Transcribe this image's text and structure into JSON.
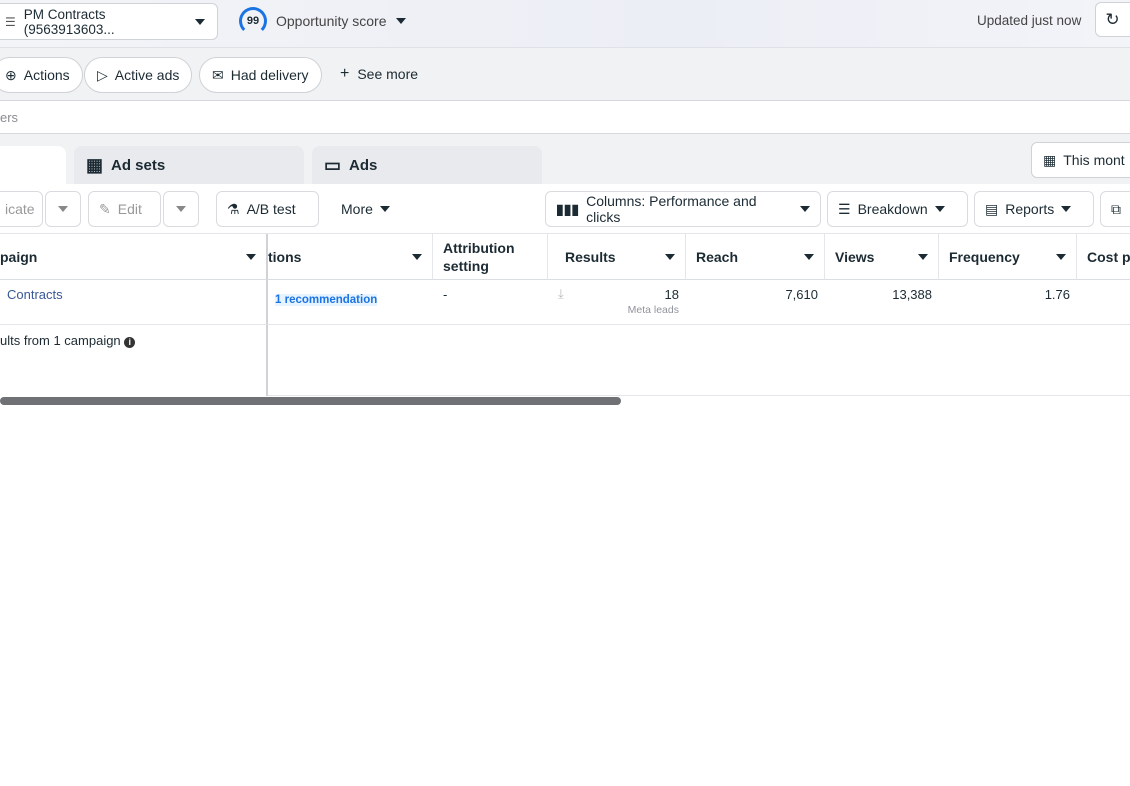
{
  "header": {
    "account": "PM Contracts (9563913603...",
    "opportunity_score": "99",
    "opportunity_label": "Opportunity score",
    "updated": "Updated just now"
  },
  "filters": {
    "pills": [
      "Actions",
      "Active ads",
      "Had delivery"
    ],
    "see_more": "See more",
    "search_placeholder": "ers"
  },
  "tabs": {
    "ad_sets": "Ad sets",
    "ads": "Ads",
    "date": "This mont"
  },
  "toolbar": {
    "duplicate": "icate",
    "edit": "Edit",
    "ab_test": "A/B test",
    "more": "More",
    "columns": "Columns: Performance and clicks",
    "breakdown": "Breakdown",
    "reports": "Reports"
  },
  "table": {
    "headers": {
      "campaign": "paign",
      "actions": "tions",
      "attribution": "Attribution setting",
      "results": "Results",
      "reach": "Reach",
      "views": "Views",
      "frequency": "Frequency",
      "cost": "Cost p"
    },
    "row": {
      "campaign": "Contracts",
      "recommendation": "1 recommendation",
      "attribution": "-",
      "results": "18",
      "results_sub": "Meta leads",
      "reach": "7,610",
      "views": "13,388",
      "frequency": "1.76"
    },
    "summary": "ults from 1 campaign"
  },
  "colors": {
    "accent": "#0a78be",
    "link": "#385898",
    "score_ring": "#1b74e4"
  }
}
